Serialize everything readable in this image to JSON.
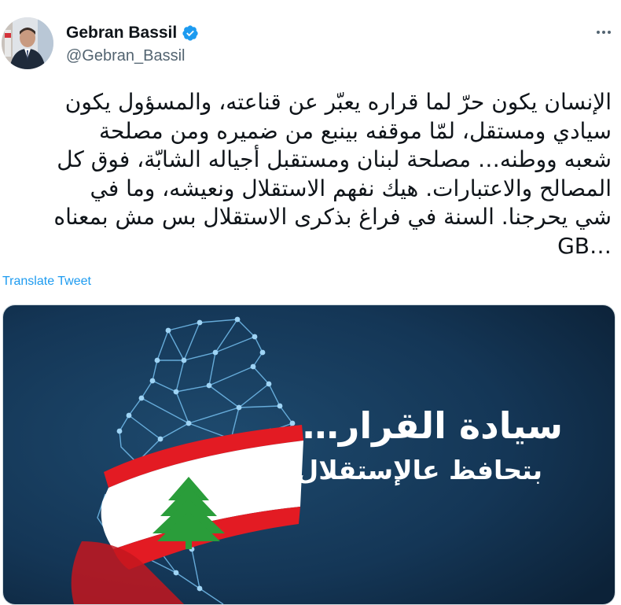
{
  "author": {
    "name": "Gebran Bassil",
    "handle": "@Gebran_Bassil",
    "verified_icon": "verified-badge-icon"
  },
  "tweet": {
    "text": "الإنسان يكون حرّ لما قراره يعبّر عن قناعته، والمسؤول يكون\nسيادي ومستقل، لمّا موقفه بينبع من ضميره ومن مصلحة\nشعبه ووطنه… مصلحة لبنان ومستقبل أجياله الشابّة، فوق كل\nالمصالح والاعتبارات. هيك نفهم الاستقلال ونعيشه، وما في\nشي يحرجنا. السنة في فراغ بذكرى الاستقلال بس مش بمعناه\nGB…",
    "translate_label": "Translate Tweet"
  },
  "media": {
    "headline": "سيادة القرار…",
    "subline": "بتحافظ عالإستقلال"
  },
  "colors": {
    "link": "#1d9bf0",
    "verified": "#1d9bf0",
    "media_bg": "#13324f",
    "flag_red": "#e31b23",
    "cedar_green": "#2a9d3a"
  }
}
